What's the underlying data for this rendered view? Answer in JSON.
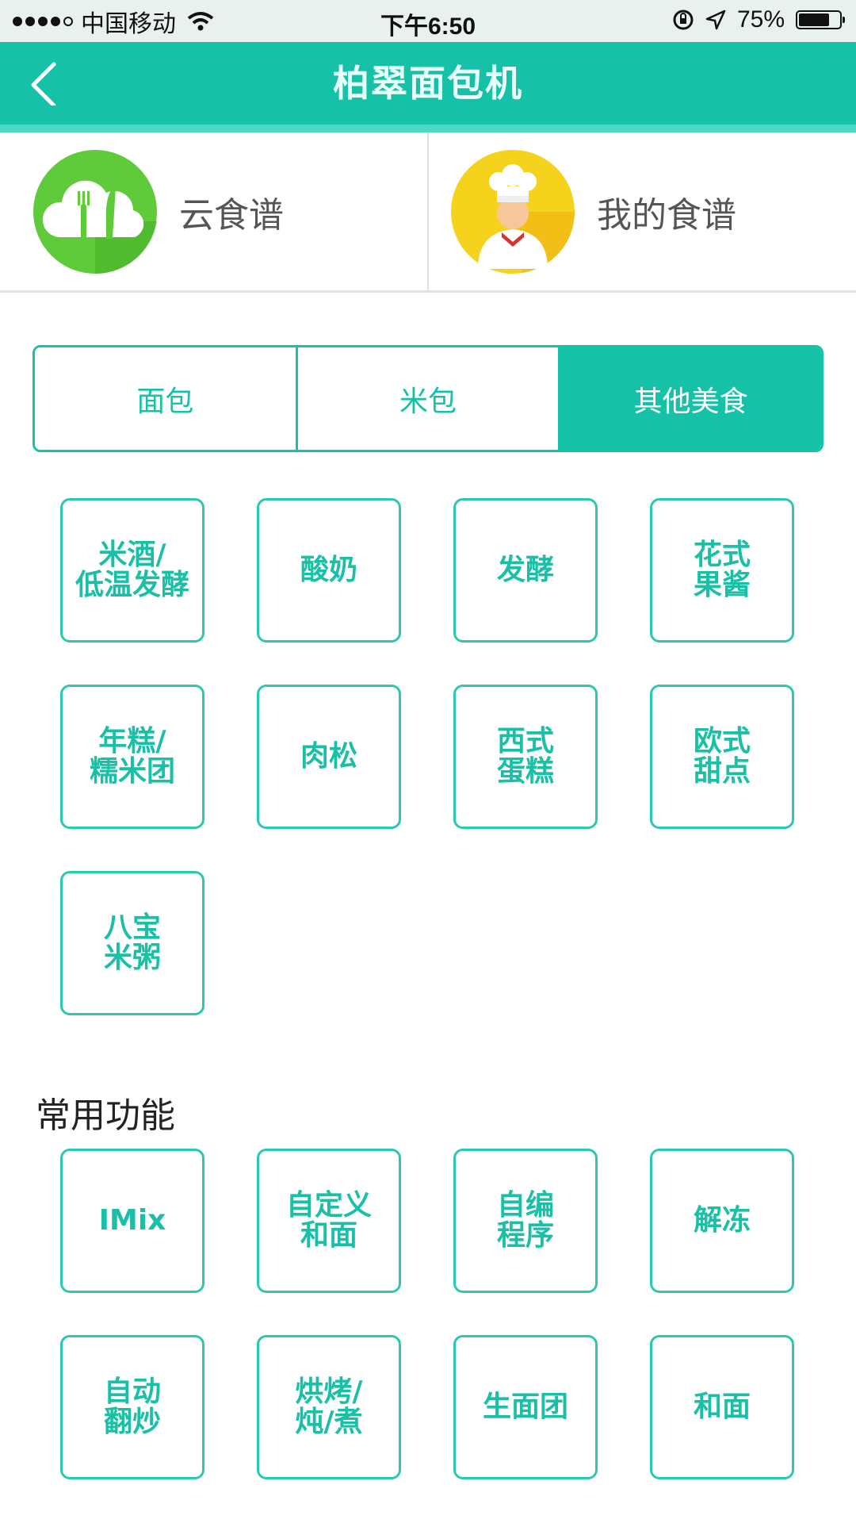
{
  "status_bar": {
    "carrier": "中国移动",
    "time": "下午6:50",
    "battery": "75%",
    "battery_level": 0.75
  },
  "nav": {
    "title": "柏翠面包机",
    "back_icon": "chevron-left-icon"
  },
  "recipes": {
    "cloud": {
      "label": "云食谱",
      "icon": "cloud-fork-knife-icon",
      "color": "#5fca3a"
    },
    "mine": {
      "label": "我的食谱",
      "icon": "chef-icon",
      "color": "#f5d21c"
    }
  },
  "tabs": [
    {
      "label": "面包",
      "active": false
    },
    {
      "label": "米包",
      "active": false
    },
    {
      "label": "其他美食",
      "active": true
    }
  ],
  "programs": [
    "米酒/\n低温发酵",
    "酸奶",
    "发酵",
    "花式\n果酱",
    "年糕/\n糯米团",
    "肉松",
    "西式\n蛋糕",
    "欧式\n甜点",
    "八宝\n米粥"
  ],
  "common": {
    "title": "常用功能",
    "items": [
      "IMix",
      "自定义\n和面",
      "自编\n程序",
      "解冻",
      "自动\n翻炒",
      "烘烤/\n炖/煮",
      "生面团",
      "和面"
    ]
  },
  "colors": {
    "accent": "#15c2a7",
    "statusbar": "#e9f1ef"
  }
}
